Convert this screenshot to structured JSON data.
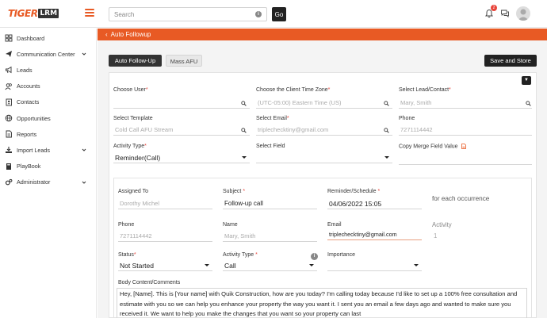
{
  "brand": {
    "name_part1": "TIGER",
    "name_part2": "LRM",
    "accent": "#e85a24"
  },
  "search": {
    "placeholder": "Search",
    "go_label": "Go"
  },
  "notifications": {
    "count": "2"
  },
  "sidebar": {
    "items": [
      {
        "label": "Dashboard",
        "icon": "grid-icon",
        "has_children": false
      },
      {
        "label": "Communication Center",
        "icon": "paper-plane-icon",
        "has_children": true
      },
      {
        "label": "Leads",
        "icon": "megaphone-icon",
        "has_children": false
      },
      {
        "label": "Accounts",
        "icon": "users-icon",
        "has_children": false
      },
      {
        "label": "Contacts",
        "icon": "address-book-icon",
        "has_children": false
      },
      {
        "label": "Opportunities",
        "icon": "globe-icon",
        "has_children": false
      },
      {
        "label": "Reports",
        "icon": "file-icon",
        "has_children": false
      },
      {
        "label": "Import Leads",
        "icon": "download-icon",
        "has_children": true
      },
      {
        "label": "PlayBook",
        "icon": "book-icon",
        "has_children": false
      },
      {
        "label": "Administrator",
        "icon": "gears-icon",
        "has_children": true
      }
    ]
  },
  "page": {
    "back_glyph": "‹",
    "title": "Auto Followup",
    "tabs": [
      {
        "label": "Auto Follow-Up",
        "active": true
      },
      {
        "label": "Mass AFU",
        "active": false
      }
    ],
    "save_label": "Save and Store",
    "collapse_glyph": "▼"
  },
  "form": {
    "choose_user": {
      "label": "Choose User",
      "value": ""
    },
    "time_zone": {
      "label": "Choose the Client Time Zone",
      "value": "(UTC-05:00) Eastern Time (US)"
    },
    "lead_contact": {
      "label": "Select Lead/Contact",
      "value": "Mary, Smith"
    },
    "template": {
      "label": "Select Template",
      "value": "Cold Call AFU Stream"
    },
    "email": {
      "label": "Select Email",
      "value": "triplechecktiny@gmail.com"
    },
    "phone": {
      "label": "Phone",
      "value": "7271114442"
    },
    "activity_type": {
      "label": "Activity Type",
      "value": "Reminder(Call)"
    },
    "select_field": {
      "label": "Select Field",
      "value": ""
    },
    "merge_field": {
      "label": "Copy Merge Field Value",
      "value": ""
    }
  },
  "activity": {
    "assigned_to": {
      "label": "Assigned To",
      "value": "Dorothy Michel"
    },
    "subject": {
      "label": "Subject",
      "value": "Follow-up call"
    },
    "reminder": {
      "label": "Reminder/Schedule",
      "value": "04/06/2022 15:05"
    },
    "occurrence_text": "for each occurrence",
    "phone": {
      "label": "Phone",
      "value": "7271114442"
    },
    "name": {
      "label": "Name",
      "value": "Mary, Smith"
    },
    "email": {
      "label": "Email",
      "value": "triplechecktiny@gmail.com"
    },
    "activity_number": {
      "label": "Activity",
      "value": "1"
    },
    "status": {
      "label": "Status",
      "value": "Not Started"
    },
    "activity_type": {
      "label": "Activity Type",
      "value": "Call"
    },
    "importance": {
      "label": "Importance",
      "value": ""
    },
    "body": {
      "label": "Body Content/Comments",
      "value": "Hey, [Name]. This is [Your name] with Quik Construction, how are you today? I'm calling today because I'd like to set up a 100% free consultation and estimate with you so we can help you enhance your property the way you want it. I sent you an email a few days ago and wanted to make sure you received it. We want to help you make the changes that you want so your property can last"
    }
  }
}
